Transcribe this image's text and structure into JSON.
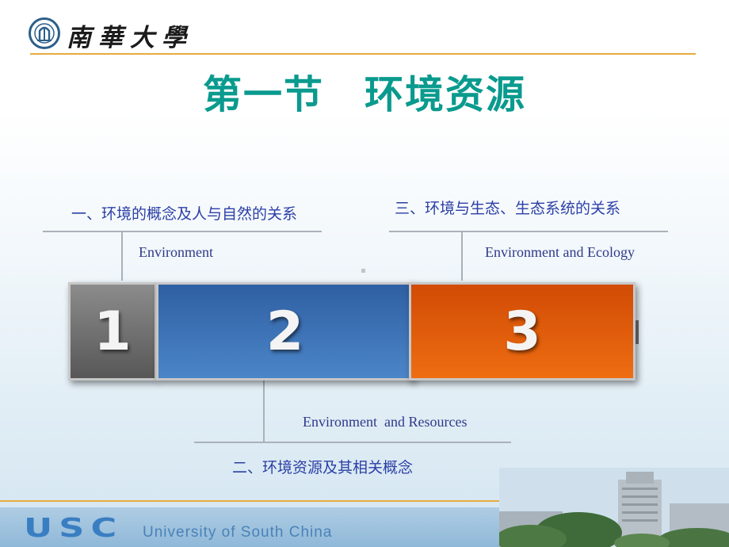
{
  "header": {
    "university_name": "南華大學",
    "title": "第一节　环境资源"
  },
  "items": [
    {
      "number": "1",
      "cn": "一、环境的概念及人与自然的关系",
      "en": "Environment",
      "color": "#6f6f6f"
    },
    {
      "number": "2",
      "cn": "二、环境资源及其相关概念",
      "en": "Environment  and Resources",
      "color": "#3a6fb5"
    },
    {
      "number": "3",
      "cn": "三、环境与生态、生态系统的关系",
      "en": "Environment and Ecology",
      "color": "#e05c0a"
    }
  ],
  "footer": {
    "abbr": "USC",
    "full_name": "University of South China"
  },
  "colors": {
    "title": "#0a9a8e",
    "accent_rule": "#e7ab3e",
    "label_text": "#2b3fa6"
  },
  "icons": {
    "logo": "university-emblem-icon"
  }
}
